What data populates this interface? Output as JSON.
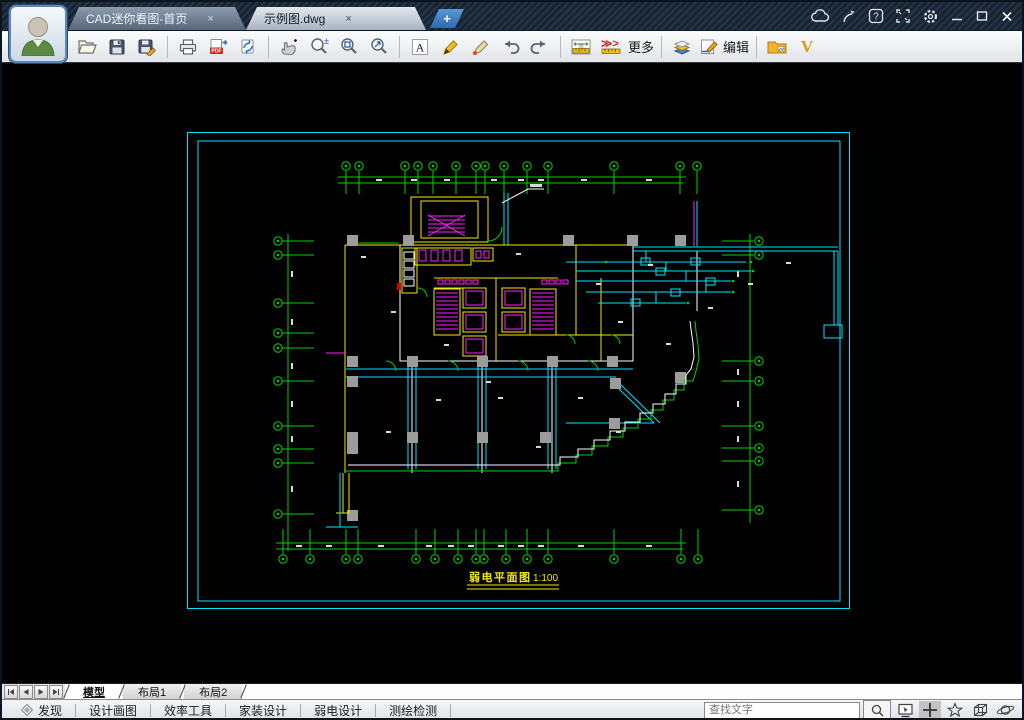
{
  "titlebar": {
    "tabs": [
      {
        "label": "CAD迷你看图-首页",
        "close": "×"
      },
      {
        "label": "示例图.dwg",
        "close": "×"
      }
    ],
    "new_tab": "+"
  },
  "toolbar": {
    "more_label": "更多",
    "edit_label": "编辑",
    "text_tool": "A",
    "brand_v": "V"
  },
  "drawing": {
    "title": "弱电平面图",
    "scale": "1:100"
  },
  "sheet_tabs": {
    "labels": [
      "模型",
      "布局1",
      "布局2"
    ]
  },
  "statusbar": {
    "buttons": [
      "发现",
      "设计画图",
      "效率工具",
      "家装设计",
      "弱电设计",
      "测绘检测"
    ],
    "search_placeholder": "查找文字"
  },
  "colors": {
    "frame_cyan": "#00e5ff",
    "grid_green": "#00d400",
    "wall_yellow": "#f5e800",
    "detail_magenta": "#ff20ff",
    "canvas_black": "#000000"
  }
}
